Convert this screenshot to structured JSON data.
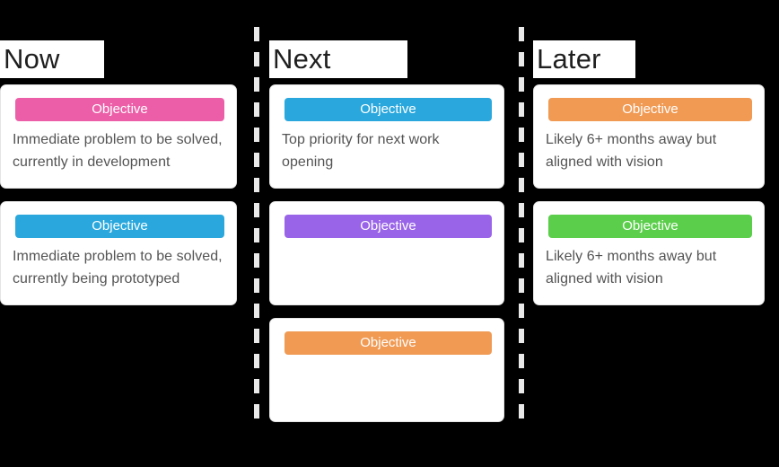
{
  "board": {
    "background_color": "#000000",
    "divider_style": "dashed",
    "divider_color": "#e9e9e9",
    "columns": [
      {
        "id": "now",
        "header": "Now",
        "cards": [
          {
            "tag_label": "Objective",
            "tag_color": "#ec5fa8",
            "body": "Immediate problem to be solved, currently in development"
          },
          {
            "tag_label": "Objective",
            "tag_color": "#2aa8dd",
            "body": "Immediate problem to be solved, currently being prototyped"
          }
        ]
      },
      {
        "id": "next",
        "header": "Next",
        "cards": [
          {
            "tag_label": "Objective",
            "tag_color": "#2aa8dd",
            "body": "Top priority for next work opening"
          },
          {
            "tag_label": "Objective",
            "tag_color": "#9964e8",
            "body": ""
          },
          {
            "tag_label": "Objective",
            "tag_color": "#f09a54",
            "body": ""
          }
        ]
      },
      {
        "id": "later",
        "header": "Later",
        "cards": [
          {
            "tag_label": "Objective",
            "tag_color": "#f09a54",
            "body": "Likely 6+ months away but aligned with vision"
          },
          {
            "tag_label": "Objective",
            "tag_color": "#5bce4b",
            "body": "Likely 6+ months away but aligned with vision"
          }
        ]
      }
    ]
  }
}
